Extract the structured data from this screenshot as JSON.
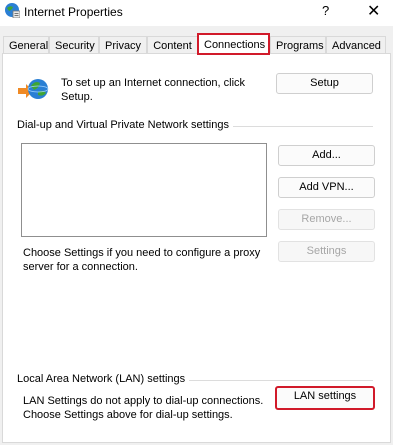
{
  "window": {
    "title": "Internet Properties",
    "help_label": "?",
    "close_label": "✕"
  },
  "tabs": [
    {
      "label": "General"
    },
    {
      "label": "Security"
    },
    {
      "label": "Privacy"
    },
    {
      "label": "Content"
    },
    {
      "label": "Connections",
      "active": true
    },
    {
      "label": "Programs"
    },
    {
      "label": "Advanced"
    }
  ],
  "setup": {
    "description": "To set up an Internet connection, click Setup.",
    "button_label": "Setup"
  },
  "dialup": {
    "group_label": "Dial-up and Virtual Private Network settings",
    "add_label": "Add...",
    "add_vpn_label": "Add VPN...",
    "remove_label": "Remove...",
    "settings_label": "Settings",
    "proxy_text": "Choose Settings if you need to configure a proxy server for a connection."
  },
  "lan": {
    "group_label": "Local Area Network (LAN) settings",
    "text": "LAN Settings do not apply to dial-up connections. Choose Settings above for dial-up settings.",
    "button_label": "LAN settings"
  },
  "colors": {
    "highlight": "#d11a2a"
  }
}
